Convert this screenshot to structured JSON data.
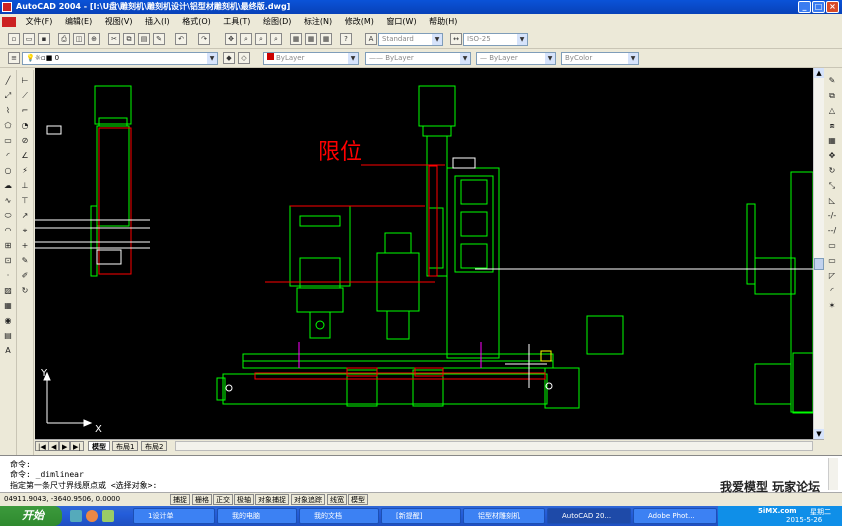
{
  "window": {
    "title": "AutoCAD 2004 - [I:\\U盘\\雕刻机\\雕刻机设计\\铝型材雕刻机\\最终版.dwg]"
  },
  "menu": [
    "文件(F)",
    "编辑(E)",
    "视图(V)",
    "插入(I)",
    "格式(O)",
    "工具(T)",
    "绘图(D)",
    "标注(N)",
    "修改(M)",
    "窗口(W)",
    "帮助(H)"
  ],
  "toolbar_styles": {
    "text_style": "Standard",
    "dim_style": "ISO-25"
  },
  "toolbar_props": {
    "layer": "0",
    "color": "ByLayer",
    "linetype": "ByLayer",
    "lineweight": "ByLayer",
    "plotstyle": "ByColor"
  },
  "drawing": {
    "annotation": "限位",
    "colors": {
      "background": "#000000",
      "outline": "#00ff00",
      "accent": "#ff0000",
      "white": "#ffffff",
      "magenta": "#ff00ff"
    },
    "ucs_y": "Y",
    "ucs_x": "X"
  },
  "layout_tabs": [
    "模型",
    "布局1",
    "布局2"
  ],
  "command_lines": [
    "命令:",
    "命令: _dimlinear",
    "指定第一条尺寸界线原点或 <选择对象>:"
  ],
  "status": {
    "coords": "04911.9043, -3640.9506, 0.0000",
    "toggles": [
      "捕捉",
      "栅格",
      "正交",
      "极轴",
      "对象捕捉",
      "对象追踪",
      "线宽",
      "模型"
    ]
  },
  "watermark": "我爱模型 玩家论坛",
  "taskbar": {
    "start": "开始",
    "tasks": [
      "1设计单",
      "我的电脑",
      "我的文档",
      "[新提醒]",
      "铝型材雕刻机",
      "AutoCAD 20...",
      "Adobe Phot..."
    ],
    "tray_clock": "星期二",
    "tray_date": "2015-5-26",
    "tray_site": "5iMX.com"
  }
}
